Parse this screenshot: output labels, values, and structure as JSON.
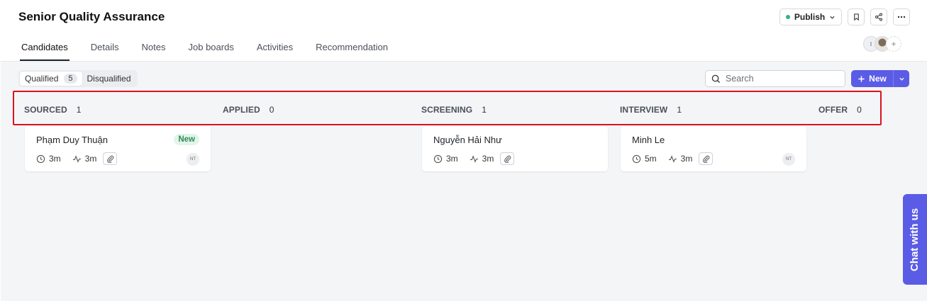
{
  "header": {
    "title": "Senior Quality Assurance",
    "publish_label": "Publish",
    "bookmark_icon": "bookmark-icon",
    "share_icon": "share-icon",
    "more_icon": "more-icon"
  },
  "tabs": [
    {
      "label": "Candidates",
      "active": true
    },
    {
      "label": "Details"
    },
    {
      "label": "Notes"
    },
    {
      "label": "Job boards"
    },
    {
      "label": "Activities"
    },
    {
      "label": "Recommendation"
    }
  ],
  "team_avatars": [
    {
      "initials": "I"
    },
    {
      "initials": ""
    }
  ],
  "filters": {
    "qualified_label": "Qualified",
    "qualified_count": "5",
    "disqualified_label": "Disqualified"
  },
  "search": {
    "placeholder": "Search"
  },
  "new_button": {
    "label": "New"
  },
  "stages": [
    {
      "name": "SOURCED",
      "count": "1"
    },
    {
      "name": "APPLIED",
      "count": "0"
    },
    {
      "name": "SCREENING",
      "count": "1"
    },
    {
      "name": "INTERVIEW",
      "count": "1"
    },
    {
      "name": "OFFER",
      "count": "0"
    }
  ],
  "cards": [
    {
      "name": "Phạm Duy Thuận",
      "tag": "New",
      "time_in_stage": "3m",
      "activity": "3m",
      "owner_initials": "NT"
    },
    {
      "name": "Nguyễn Hải Như",
      "time_in_stage": "3m",
      "activity": "3m"
    },
    {
      "name": "Minh Le",
      "time_in_stage": "5m",
      "activity": "3m",
      "owner_initials": "NT"
    }
  ],
  "chat": {
    "label": "Chat with us"
  },
  "colors": {
    "accent": "#5b5ce6",
    "highlight": "#d9121f",
    "tag_green": "#2e8b57",
    "publish_dot": "#35b37e"
  }
}
